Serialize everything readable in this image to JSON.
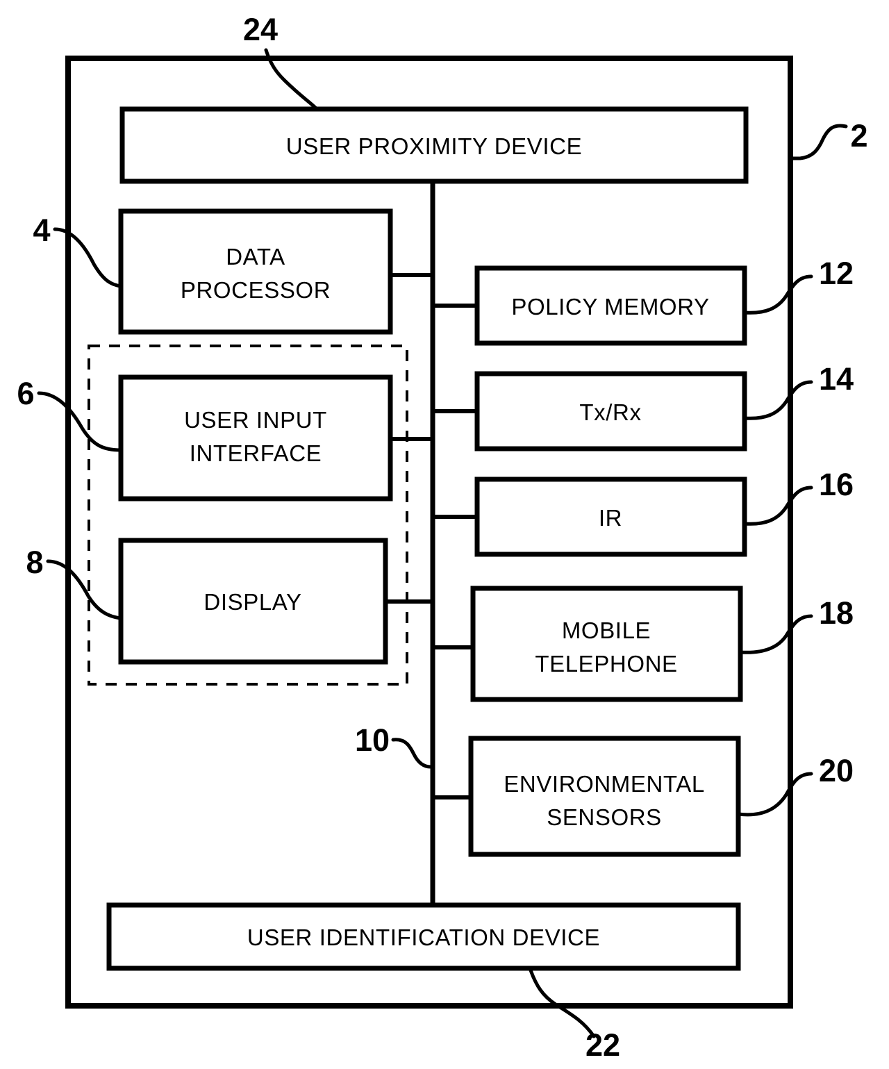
{
  "figure": {
    "type": "patent-block-diagram",
    "outer_container": {
      "name": "system-enclosure",
      "reference_numeral": "2"
    },
    "blocks": [
      {
        "id": "user-proximity-device",
        "label": "USER PROXIMITY DEVICE",
        "lines": [
          "USER PROXIMITY DEVICE"
        ],
        "reference_numeral": "24"
      },
      {
        "id": "data-processor",
        "label": "DATA PROCESSOR",
        "lines": [
          "DATA",
          "PROCESSOR"
        ],
        "reference_numeral": "4"
      },
      {
        "id": "user-input-interface",
        "label": "USER INPUT INTERFACE",
        "lines": [
          "USER INPUT",
          "INTERFACE"
        ],
        "reference_numeral": "6"
      },
      {
        "id": "display",
        "label": "DISPLAY",
        "lines": [
          "DISPLAY"
        ],
        "reference_numeral": "8"
      },
      {
        "id": "policy-memory",
        "label": "POLICY MEMORY",
        "lines": [
          "POLICY MEMORY"
        ],
        "reference_numeral": "12"
      },
      {
        "id": "tx-rx",
        "label": "Tx/Rx",
        "lines": [
          "Tx/Rx"
        ],
        "reference_numeral": "14"
      },
      {
        "id": "ir",
        "label": "IR",
        "lines": [
          "IR"
        ],
        "reference_numeral": "16"
      },
      {
        "id": "mobile-telephone",
        "label": "MOBILE TELEPHONE",
        "lines": [
          "MOBILE",
          "TELEPHONE"
        ],
        "reference_numeral": "18"
      },
      {
        "id": "environmental-sensors",
        "label": "ENVIRONMENTAL SENSORS",
        "lines": [
          "ENVIRONMENTAL",
          "SENSORS"
        ],
        "reference_numeral": "20"
      },
      {
        "id": "user-identification-device",
        "label": "USER IDENTIFICATION DEVICE",
        "lines": [
          "USER IDENTIFICATION DEVICE"
        ],
        "reference_numeral": "22"
      }
    ],
    "bus": {
      "id": "internal-bus",
      "reference_numeral": "10"
    },
    "dashed_group": {
      "id": "user-interface-group",
      "members": [
        "user-input-interface",
        "display"
      ]
    },
    "reference_numerals": {
      "n2": "2",
      "n4": "4",
      "n6": "6",
      "n8": "8",
      "n10": "10",
      "n12": "12",
      "n14": "14",
      "n16": "16",
      "n18": "18",
      "n20": "20",
      "n22": "22",
      "n24": "24"
    },
    "colors": {
      "ink": "#000000",
      "paper": "#ffffff"
    }
  }
}
